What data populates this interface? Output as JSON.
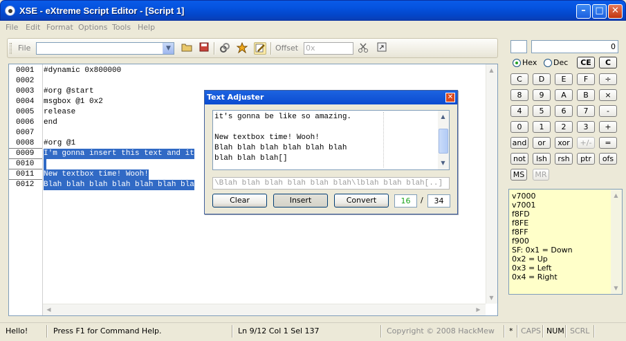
{
  "window": {
    "title": "XSE - eXtreme Script Editor - [Script 1]",
    "minimize_glyph": "–",
    "maximize_glyph": "□",
    "close_glyph": "✕"
  },
  "menu": [
    "File",
    "Edit",
    "Format",
    "Options",
    "Tools",
    "Help"
  ],
  "toolbar": {
    "file_label": "File",
    "file_value": "",
    "offset_label": "Offset",
    "offset_value": "0x",
    "icons": [
      "open-folder-icon",
      "save-icon",
      "compile-icon",
      "debug-icon",
      "text-adjuster-icon",
      "cut-icon",
      "goto-icon"
    ],
    "combo_arrow": "▼"
  },
  "editor": {
    "line_numbers": [
      "0001",
      "0002",
      "0003",
      "0004",
      "0005",
      "0006",
      "0007",
      "0008",
      "0009",
      "0010",
      "0011",
      "0012"
    ],
    "lines": [
      "#dynamic 0x800000",
      "",
      "#org @start",
      "msgbox @1 0x2",
      "release",
      "end",
      "",
      "#org @1",
      "I'm gonna insert this text and it",
      "",
      "New textbox time! Wooh!",
      "Blah blah blah blah blah blah bla"
    ],
    "selected_lines": [
      8,
      9,
      10,
      11
    ]
  },
  "dialog": {
    "title": "Text Adjuster",
    "close_glyph": "✕",
    "text_lines": [
      "it's gonna be like so amazing.",
      "",
      "New textbox time! Wooh!",
      "Blah blah blah blah blah blah",
      "blah blah blah[]"
    ],
    "output": "\\Blah blah blah blah blah blah\\lblah blah blah[..]",
    "buttons": {
      "clear": "Clear",
      "insert": "Insert",
      "convert": "Convert"
    },
    "count_current": "16",
    "count_separator": "/",
    "count_max": "34",
    "count_color": "#1aa31a"
  },
  "calculator": {
    "small_display": "",
    "display": "0",
    "hex_label": "Hex",
    "dec_label": "Dec",
    "mode": "Hex",
    "ce": "CE",
    "c": "C",
    "rows": [
      [
        "C",
        "D",
        "E",
        "F",
        "÷"
      ],
      [
        "8",
        "9",
        "A",
        "B",
        "×"
      ],
      [
        "4",
        "5",
        "6",
        "7",
        "-"
      ],
      [
        "0",
        "1",
        "2",
        "3",
        "+"
      ],
      [
        "and",
        "or",
        "xor",
        "+/-",
        "="
      ],
      [
        "not",
        "lsh",
        "rsh",
        "ptr",
        "ofs"
      ]
    ],
    "ms": "MS",
    "mr": "MR",
    "notes": [
      "v7000",
      "v7001",
      "f8FD",
      "f8FE",
      "f8FF",
      "f900",
      "SF: 0x1 = Down",
      "0x2 = Up",
      "0x3 = Left",
      "0x4 = Right"
    ]
  },
  "status": {
    "left": "Hello!",
    "help": "Press F1 for Command Help.",
    "position": "Ln 9/12  Col 1  Sel 137",
    "copyright": "Copyright © 2008 HackMew",
    "modified": "*",
    "caps": "CAPS",
    "num": "NUM",
    "scrl": "SCRL"
  },
  "scroll_glyphs": {
    "up": "▲",
    "down": "▼",
    "left": "◀",
    "right": "▶"
  }
}
